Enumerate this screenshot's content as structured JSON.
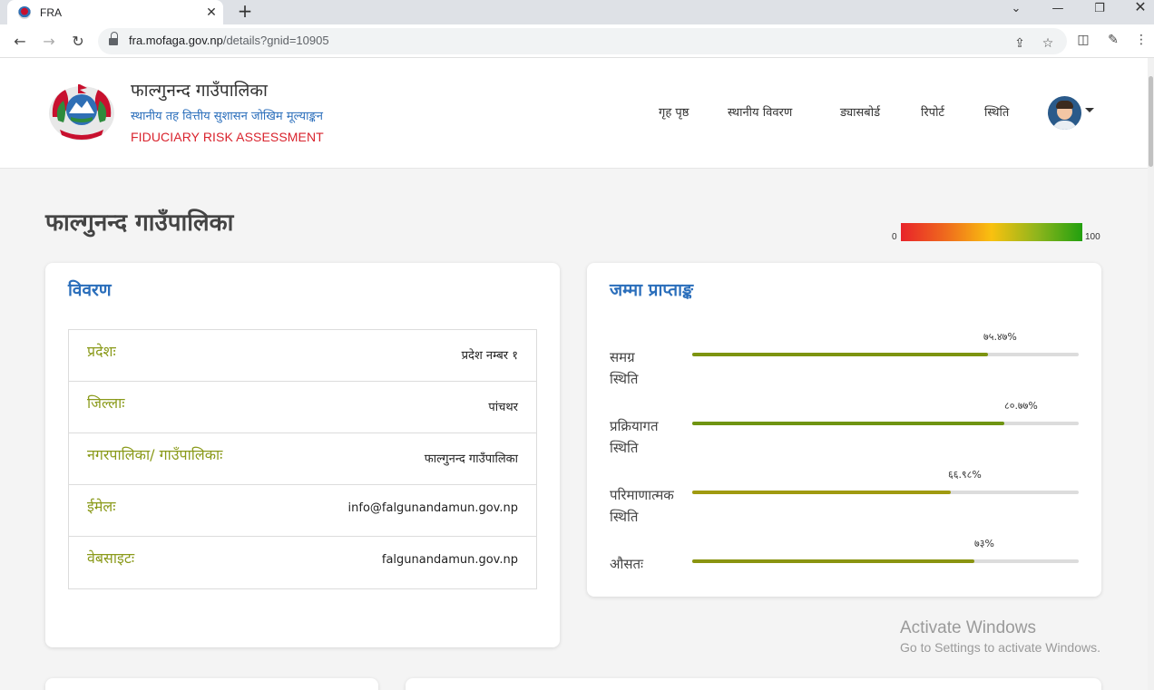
{
  "browser": {
    "tab_title": "FRA",
    "tab_close": "✕",
    "new_tab": "+",
    "url_host": "fra.mofaga.gov.np",
    "url_path": "/details?gnid=10905"
  },
  "header": {
    "name": "फाल्गुनन्द गाउँपालिका",
    "subtitle": "स्थानीय तह वित्तीय सुशासन जोखिम मूल्याङ्कन",
    "english": "FIDUCIARY RISK ASSESSMENT",
    "nav": [
      "गृह पृष्ठ",
      "स्थानीय विवरण",
      "ड्यासबोर्ड",
      "रिपोर्ट",
      "स्थिति"
    ]
  },
  "main": {
    "title": "फाल्गुनन्द गाउँपालिका",
    "scale_min": "0",
    "scale_max": "100"
  },
  "details": {
    "title": "विवरण",
    "rows": [
      {
        "label": "प्रदेशः",
        "value": "प्रदेश नम्बर १"
      },
      {
        "label": "जिल्लाः",
        "value": "पांचथर"
      },
      {
        "label": "नगरपालिका/ गाउँपालिकाः",
        "value": "फाल्गुनन्द गाउँपालिका"
      },
      {
        "label": "ईमेलः",
        "value": "info@falgunandamun.gov.np"
      },
      {
        "label": "वेबसाइटः",
        "value": "falgunandamun.gov.np"
      }
    ]
  },
  "scores": {
    "title": "जम्मा प्राप्ताङ्क",
    "items": [
      {
        "label_1": "समग्र",
        "label_2": "स्थिति",
        "pct_text": "७५.४७%",
        "value": 76.47,
        "color": "#7d9410"
      },
      {
        "label_1": "प्रक्रियागत",
        "label_2": "स्थिति",
        "pct_text": "८०.७७%",
        "value": 80.77,
        "color": "#6f9412"
      },
      {
        "label_1": "परिमाणात्मक",
        "label_2": "स्थिति",
        "pct_text": "६६.९८%",
        "value": 66.98,
        "color": "#a09a10"
      },
      {
        "label_1": "औसतः",
        "label_2": "",
        "pct_text": "७३%",
        "value": 73,
        "color": "#8a9410"
      }
    ]
  },
  "watermark": {
    "line1": "Activate Windows",
    "line2": "Go to Settings to activate Windows."
  }
}
